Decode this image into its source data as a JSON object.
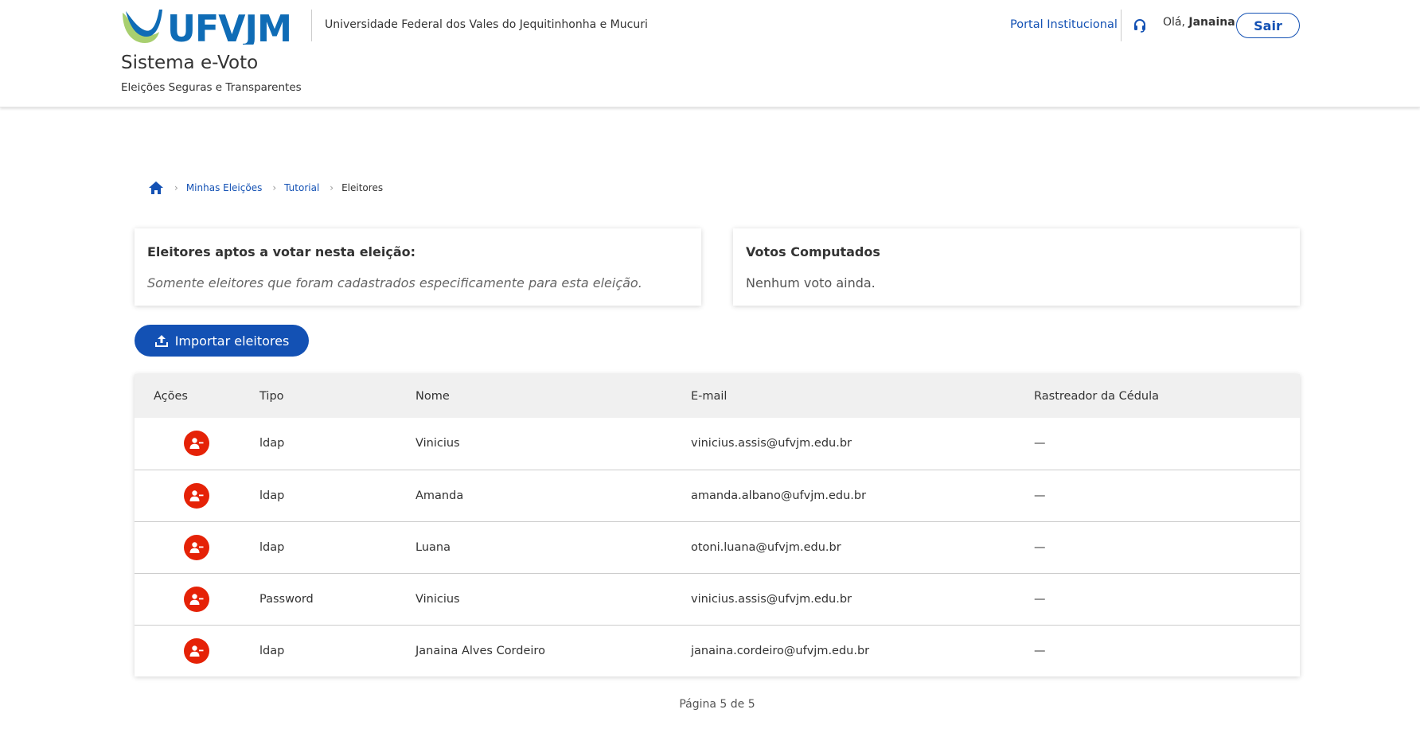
{
  "header": {
    "logo_text": "UFVJM",
    "university_name": "Universidade Federal dos Vales do Jequitinhonha e Mucuri",
    "app_title": "Sistema e-Voto",
    "app_subtitle": "Eleições Seguras e Transparentes",
    "portal_link": "Portal Institucional",
    "support_icon": "headset-icon",
    "greeting_prefix": "Olá, ",
    "user_name": "Janaina",
    "logout_label": "Sair"
  },
  "breadcrumb": {
    "home_icon": "home-icon",
    "items": [
      {
        "label": "Minhas Eleições"
      },
      {
        "label": "Tutorial"
      }
    ],
    "current": "Eleitores"
  },
  "cards": {
    "eligible": {
      "title": "Eleitores aptos a votar nesta eleição:",
      "text": "Somente eleitores que foram cadastrados especificamente para esta eleição."
    },
    "votes": {
      "title": "Votos Computados",
      "text": "Nenhum voto ainda."
    }
  },
  "import_button": {
    "label": "Importar eleitores",
    "icon": "upload-icon"
  },
  "table": {
    "headers": {
      "actions": "Ações",
      "type": "Tipo",
      "name": "Nome",
      "email": "E-mail",
      "tracker": "Rastreador da Cédula"
    },
    "rows": [
      {
        "type": "ldap",
        "name": "Vinicius",
        "email": "vinicius.assis@ufvjm.edu.br",
        "tracker": "—"
      },
      {
        "type": "ldap",
        "name": "Amanda",
        "email": "amanda.albano@ufvjm.edu.br",
        "tracker": "—"
      },
      {
        "type": "ldap",
        "name": "Luana",
        "email": "otoni.luana@ufvjm.edu.br",
        "tracker": "—"
      },
      {
        "type": "Password",
        "name": "Vinicius",
        "email": "vinicius.assis@ufvjm.edu.br",
        "tracker": "—"
      },
      {
        "type": "ldap",
        "name": "Janaina Alves Cordeiro",
        "email": "janaina.cordeiro@ufvjm.edu.br",
        "tracker": "—"
      }
    ],
    "remove_icon": "remove-user-icon"
  },
  "pagination": {
    "text": "Página 5 de 5"
  },
  "colors": {
    "primary": "#1351b4",
    "danger": "#e52207",
    "logo_green": "#a8cf6f",
    "logo_blue": "#0f6cb6"
  }
}
